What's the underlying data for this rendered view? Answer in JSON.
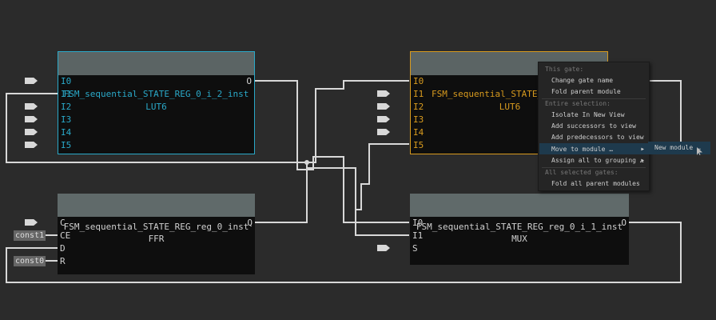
{
  "gates": {
    "lut_top_left": {
      "name": "FSM_sequential_STATE_REG_0_i_2_inst",
      "type": "LUT6",
      "inputs": [
        "I0",
        "I1",
        "I2",
        "I3",
        "I4",
        "I5"
      ],
      "output": "O"
    },
    "ffr": {
      "name": "FSM_sequential_STATE_REG_reg_0_inst",
      "type": "FFR",
      "inputs": [
        "C",
        "CE",
        "D",
        "R"
      ],
      "output": "Q"
    },
    "lut_top_right": {
      "name": "FSM_sequential_STATE_REG",
      "type": "LUT6",
      "inputs": [
        "I0",
        "I1",
        "I2",
        "I3",
        "I4",
        "I5"
      ]
    },
    "mux": {
      "name": "FSM_sequential_STATE_REG_reg_0_i_1_inst",
      "type": "MUX",
      "inputs": [
        "I0",
        "I1",
        "S"
      ],
      "output": "O"
    }
  },
  "constants": {
    "ce": "const1",
    "r": "const0"
  },
  "context_menu": {
    "section_gate": "This gate:",
    "change_gate_name": "Change gate name",
    "fold_parent_module": "Fold parent module",
    "section_selection": "Entire selection:",
    "isolate": "Isolate In New View",
    "add_successors": "Add successors to view",
    "add_predecessors": "Add predecessors to view",
    "move_to_module": "Move to module …",
    "assign_grouping": "Assign all to grouping …",
    "section_all": "All selected gates:",
    "fold_all": "Fold all parent modules"
  },
  "submenu": {
    "new_module": "New module …"
  },
  "colors": {
    "background": "#2b2b2b",
    "selected_blue": "#2aa9c9",
    "selected_orange": "#d79a1e",
    "text": "#d0d0d0",
    "wire": "#d8d8d8"
  }
}
